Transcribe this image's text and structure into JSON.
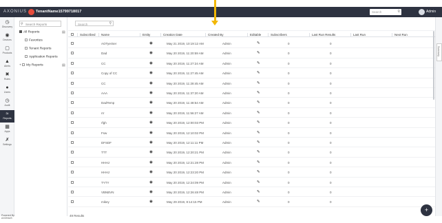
{
  "header": {
    "logo_text": "AXONIUS",
    "tenant_name": "TenantName15799718017",
    "search_placeholder": "Search",
    "user_label": "Admin"
  },
  "leftnav": {
    "items": [
      {
        "label": "Discovery",
        "icon": "dashboard-icon"
      },
      {
        "label": "Devices",
        "icon": "devices-icon"
      },
      {
        "label": "Products",
        "icon": "products-icon"
      },
      {
        "label": "Alerts",
        "icon": "alerts-icon"
      },
      {
        "label": "Rules",
        "icon": "rules-icon"
      },
      {
        "label": "Users",
        "icon": "users-icon"
      },
      {
        "label": "Audit",
        "icon": "audit-icon"
      },
      {
        "label": "Reports",
        "icon": "reports-icon"
      },
      {
        "label": "Apps",
        "icon": "apps-icon"
      },
      {
        "label": "Settings",
        "icon": "settings-icon"
      }
    ],
    "active_index": 7,
    "powered_by_line1": "Powered By",
    "powered_by_line2": "AXONIUS"
  },
  "tree": {
    "search_placeholder": "Search Reports",
    "all_reports": "All Reports",
    "children": [
      "Favorites",
      "Tenant Reports",
      "Application Reports"
    ],
    "my_reports": "My Reports"
  },
  "main": {
    "search_placeholder": "Search",
    "columns": [
      "Subscribed",
      "Name",
      "Entity",
      "Creation Date",
      "Created By",
      "Editable",
      "Subscribers",
      "Last Run Results",
      "Last Run",
      "Next Run"
    ],
    "rows": [
      {
        "name": "AOTyerSer",
        "date": "May 21 2019, 10:19:12 AM",
        "created_by": "Admin",
        "subscribers": "0",
        "last_run_results": "0"
      },
      {
        "name": "Dad",
        "date": "May 20 2019, 11:20:59 AM",
        "created_by": "Admin",
        "subscribers": "0",
        "last_run_results": "0"
      },
      {
        "name": "CC",
        "date": "May 20 2019, 11:27:24 AM",
        "created_by": "Admin",
        "subscribers": "0",
        "last_run_results": "0"
      },
      {
        "name": "Copy of CC",
        "date": "May 20 2019, 11:27:45 AM",
        "created_by": "Admin",
        "subscribers": "0",
        "last_run_results": "0"
      },
      {
        "name": "CC",
        "date": "May 20 2019, 11:28:45 AM",
        "created_by": "Admin",
        "subscribers": "0",
        "last_run_results": "0"
      },
      {
        "name": "AAA",
        "date": "May 20 2019, 11:37:20 AM",
        "created_by": "Admin",
        "subscribers": "0",
        "last_run_results": "0"
      },
      {
        "name": "DadTemp",
        "date": "May 20 2019, 11:48:54 AM",
        "created_by": "Admin",
        "subscribers": "0",
        "last_run_results": "0"
      },
      {
        "name": "rrr",
        "date": "May 20 2019, 11:56:27 AM",
        "created_by": "Admin",
        "subscribers": "0",
        "last_run_results": "0"
      },
      {
        "name": "rfgh",
        "date": "May 20 2019, 12:00:03 PM",
        "created_by": "Admin",
        "subscribers": "0",
        "last_run_results": "0"
      },
      {
        "name": "Fsw",
        "date": "May 20 2019, 12:10:02 PM",
        "created_by": "Admin",
        "subscribers": "0",
        "last_run_results": "0"
      },
      {
        "name": "DFSDF",
        "date": "May 20 2019, 12:11:11 PM",
        "created_by": "Admin",
        "subscribers": "0",
        "last_run_results": "0"
      },
      {
        "name": "TTT",
        "date": "May 20 2019, 12:20:21 PM",
        "created_by": "Admin",
        "subscribers": "0",
        "last_run_results": "0"
      },
      {
        "name": "HHHJ",
        "date": "May 20 2019, 12:21:28 PM",
        "created_by": "Admin",
        "subscribers": "0",
        "last_run_results": "0"
      },
      {
        "name": "HHHJ",
        "date": "May 20 2019, 12:23:20 PM",
        "created_by": "Admin",
        "subscribers": "0",
        "last_run_results": "0"
      },
      {
        "name": "TYTY",
        "date": "May 20 2019, 12:24:09 PM",
        "created_by": "Admin",
        "subscribers": "0",
        "last_run_results": "0"
      },
      {
        "name": "VBNBVN",
        "date": "May 20 2019, 12:26:48 PM",
        "created_by": "Admin",
        "subscribers": "0",
        "last_run_results": "0"
      },
      {
        "name": "mikey",
        "date": "May 29 2019, 8:14:15 PM",
        "created_by": "Admin",
        "subscribers": "0",
        "last_run_results": "0"
      }
    ],
    "footer_count": "49 Results"
  },
  "rightrail": {
    "tab_label": "Summary"
  },
  "fab_label": "+",
  "colors": {
    "topbar": "#2e3341",
    "accent_arrow": "#f2b705",
    "tenant_dot": "#e74c3c"
  }
}
